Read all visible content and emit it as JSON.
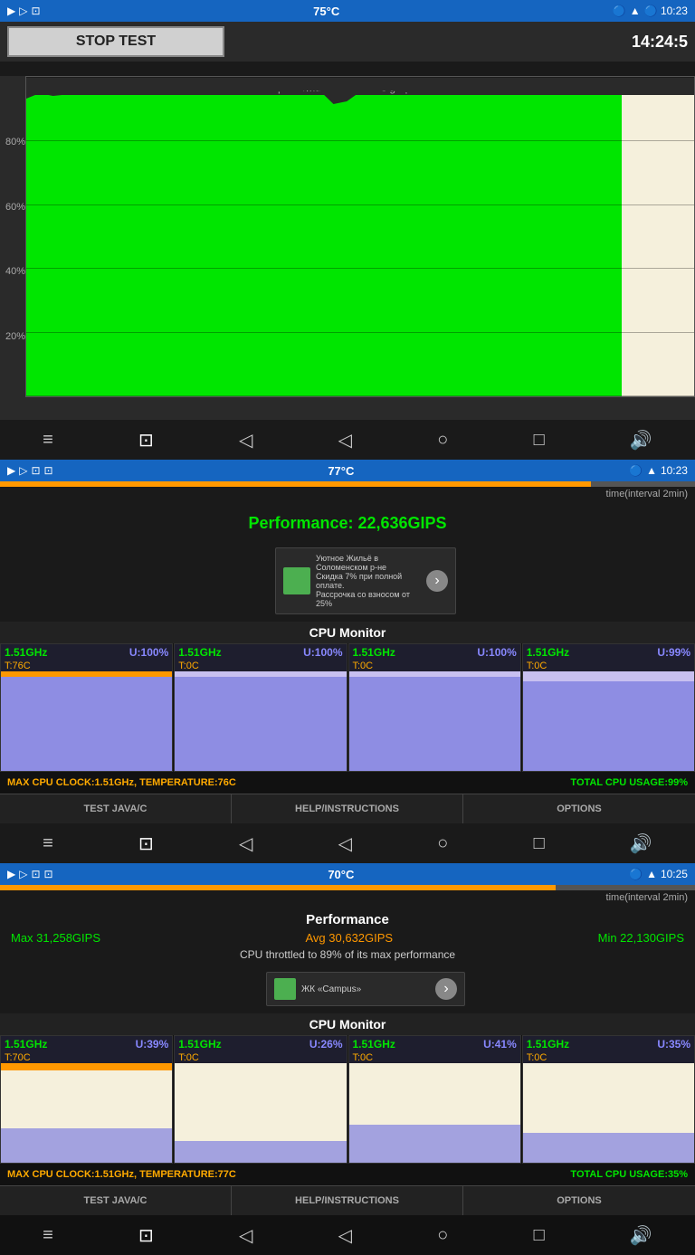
{
  "section1": {
    "status_bar": {
      "left_icons": "▶ ▷ ⊡",
      "temperature": "75°C",
      "right": "🔵 10:23"
    },
    "stop_btn": "STOP TEST",
    "time": "14:24:5",
    "graph_label": "performance over time graph",
    "y_axis": [
      "",
      "80%",
      "60%",
      "40%",
      "20%",
      ""
    ]
  },
  "section2": {
    "status_bar": {
      "temperature": "77°C",
      "time": "10:23"
    },
    "perf_label": "Performance: 22,636GIPS",
    "time_interval": "time(interval 2min)",
    "ad": {
      "text1": "Уютное Жильё в Соломенском р-не",
      "text2": "Скидка 7% при полной оплате.",
      "text3": "Рассрочка со взносом от 25%"
    },
    "cpu_monitor_title": "CPU Monitor",
    "cores": [
      {
        "freq": "1.51GHz",
        "usage": "U:100%",
        "temp": "T:76C",
        "fill_height": "95%"
      },
      {
        "freq": "1.51GHz",
        "usage": "U:100%",
        "temp": "T:0C",
        "fill_height": "95%"
      },
      {
        "freq": "1.51GHz",
        "usage": "U:100%",
        "temp": "T:0C",
        "fill_height": "95%"
      },
      {
        "freq": "1.51GHz",
        "usage": "U:99%",
        "temp": "T:0C",
        "fill_height": "90%"
      }
    ],
    "stats": {
      "clock": "MAX CPU CLOCK:1.51GHz,",
      "temp": "TEMPERATURE:76C",
      "usage": "TOTAL CPU USAGE:99%"
    },
    "tabs": [
      "TEST JAVA/C",
      "HELP/INSTRUCTIONS",
      "OPTIONS"
    ]
  },
  "section3": {
    "status_bar": {
      "temperature": "70°C",
      "time": "10:25"
    },
    "perf_title": "Performance",
    "perf_max": "Max 31,258GIPS",
    "perf_avg": "Avg 30,632GIPS",
    "perf_min": "Min 22,130GIPS",
    "throttle": "CPU throttled to 89% of its max performance",
    "time_interval": "time(interval 2min)",
    "ad": {
      "text": "ЖК «Campus»"
    },
    "cpu_monitor_title": "CPU Monitor",
    "cores": [
      {
        "freq": "1.51GHz",
        "usage": "U:39%",
        "temp": "T:70C",
        "fill_height": "35%"
      },
      {
        "freq": "1.51GHz",
        "usage": "U:26%",
        "temp": "T:0C",
        "fill_height": "22%"
      },
      {
        "freq": "1.51GHz",
        "usage": "U:41%",
        "temp": "T:0C",
        "fill_height": "38%"
      },
      {
        "freq": "1.51GHz",
        "usage": "U:35%",
        "temp": "T:0C",
        "fill_height": "30%"
      }
    ],
    "stats": {
      "clock": "MAX CPU CLOCK:1.51GHz,",
      "temp": "TEMPERATURE:77C",
      "usage": "TOTAL CPU USAGE:35%"
    },
    "tabs": [
      "TEST JAVA/C",
      "HELP/INSTRUCTIONS",
      "OPTIONS"
    ]
  },
  "nav_icons": [
    "≡",
    "⊡",
    "◁",
    "▷",
    "○",
    "□",
    "🔊"
  ]
}
